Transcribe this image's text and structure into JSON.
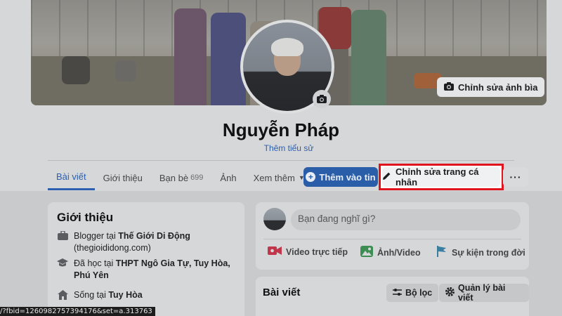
{
  "cover": {
    "edit_label": "Chỉnh sửa ảnh bìa"
  },
  "profile": {
    "name": "Nguyễn Pháp",
    "subtitle": "Thêm tiểu sử"
  },
  "tabs": [
    {
      "label": "Bài viết",
      "active": true
    },
    {
      "label": "Giới thiệu"
    },
    {
      "label": "Bạn bè",
      "count": "699"
    },
    {
      "label": "Ảnh"
    },
    {
      "label": "Xem thêm"
    }
  ],
  "actions": {
    "add_story": "Thêm vào tin",
    "edit_profile": "Chỉnh sửa trang cá nhân",
    "more": "···"
  },
  "intro": {
    "title": "Giới thiệu",
    "work_prefix": "Blogger tại ",
    "work_place": "Thế Giới Di Động",
    "work_site": "(thegioididong.com)",
    "edu_prefix": "Đã học tại ",
    "edu_place": "THPT Ngô Gia Tự, Tuy Hòa, Phú Yên",
    "live_prefix": "Sống tại ",
    "live_place": "Tuy Hòa"
  },
  "composer": {
    "placeholder": "Bạn đang nghĩ gì?",
    "live_video": "Video trực tiếp",
    "photo_video": "Ảnh/Video",
    "life_event": "Sự kiện trong đời"
  },
  "posts": {
    "title": "Bài viết",
    "filter": "Bộ lọc",
    "manage": "Quản lý bài viết"
  },
  "status_bar": {
    "url": "/?fbid=1260982757394176&set=a.313763"
  },
  "colors": {
    "accent": "#2d5fae",
    "highlight": "#e0141c",
    "primary_button": "#2a5ea8"
  }
}
